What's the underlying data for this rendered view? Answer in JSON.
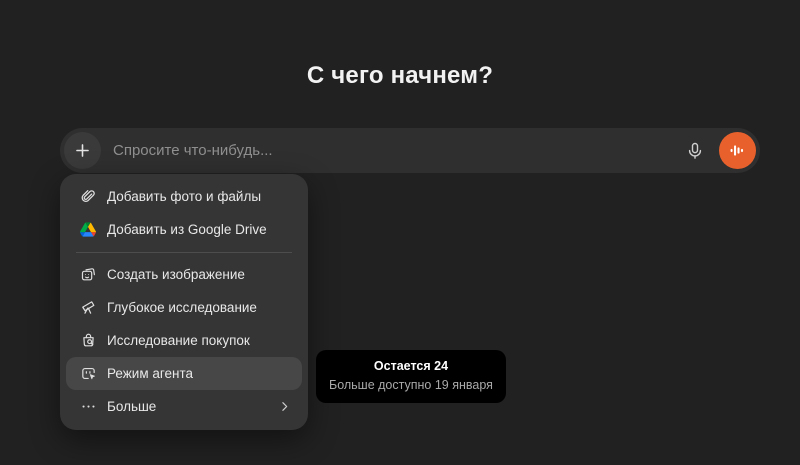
{
  "page": {
    "title": "С чего начнем?"
  },
  "composer": {
    "placeholder": "Спросите что-нибудь...",
    "value": ""
  },
  "menu": {
    "items": [
      {
        "label": "Добавить фото и файлы",
        "icon": "paperclip-icon"
      },
      {
        "label": "Добавить из Google Drive",
        "icon": "google-drive-icon"
      },
      {
        "label": "Создать изображение",
        "icon": "create-image-icon"
      },
      {
        "label": "Глубокое исследование",
        "icon": "telescope-icon"
      },
      {
        "label": "Исследование покупок",
        "icon": "shopping-research-icon"
      },
      {
        "label": "Режим агента",
        "icon": "agent-mode-icon",
        "highlighted": true
      },
      {
        "label": "Больше",
        "icon": "more-ellipsis-icon",
        "has_submenu": true
      }
    ]
  },
  "tooltip": {
    "title": "Остается 24",
    "subtitle": "Больше доступно 19 января"
  },
  "colors": {
    "background": "#212121",
    "composer_background": "#2f2f2f",
    "menu_background": "#353535",
    "highlight_row": "#474747",
    "accent_orange": "#e8612c",
    "tooltip_background": "#000000",
    "drive_blue": "#0066da",
    "drive_green": "#00ac47",
    "drive_red": "#ea4335",
    "drive_dark_green": "#00832d",
    "drive_light_blue": "#2684fc",
    "drive_yellow": "#ffba00"
  }
}
